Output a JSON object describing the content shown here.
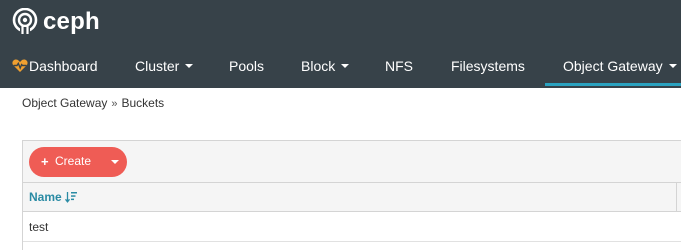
{
  "brand": {
    "name": "ceph"
  },
  "nav": {
    "items": [
      {
        "label": "Dashboard",
        "icon": "heartbeat-icon",
        "dropdown": false
      },
      {
        "label": "Cluster",
        "dropdown": true
      },
      {
        "label": "Pools",
        "dropdown": false
      },
      {
        "label": "Block",
        "dropdown": true
      },
      {
        "label": "NFS",
        "dropdown": false
      },
      {
        "label": "Filesystems",
        "dropdown": false
      },
      {
        "label": "Object Gateway",
        "dropdown": true,
        "active": true
      }
    ]
  },
  "breadcrumb": {
    "parent": "Object Gateway",
    "separator": "»",
    "current": "Buckets"
  },
  "toolbar": {
    "create_label": "Create",
    "create_icon": "plus-icon",
    "dropdown_icon": "caret-down-icon"
  },
  "table": {
    "columns": [
      {
        "label": "Name",
        "sort_icon": "sort-amount-down-icon"
      }
    ],
    "rows": [
      {
        "name": "test"
      }
    ]
  },
  "colors": {
    "topbar": "#374249",
    "accent": "#2aa2c0",
    "create_button": "#ef5c55",
    "heart": "#f0a030",
    "column_header": "#2a8ba4"
  }
}
